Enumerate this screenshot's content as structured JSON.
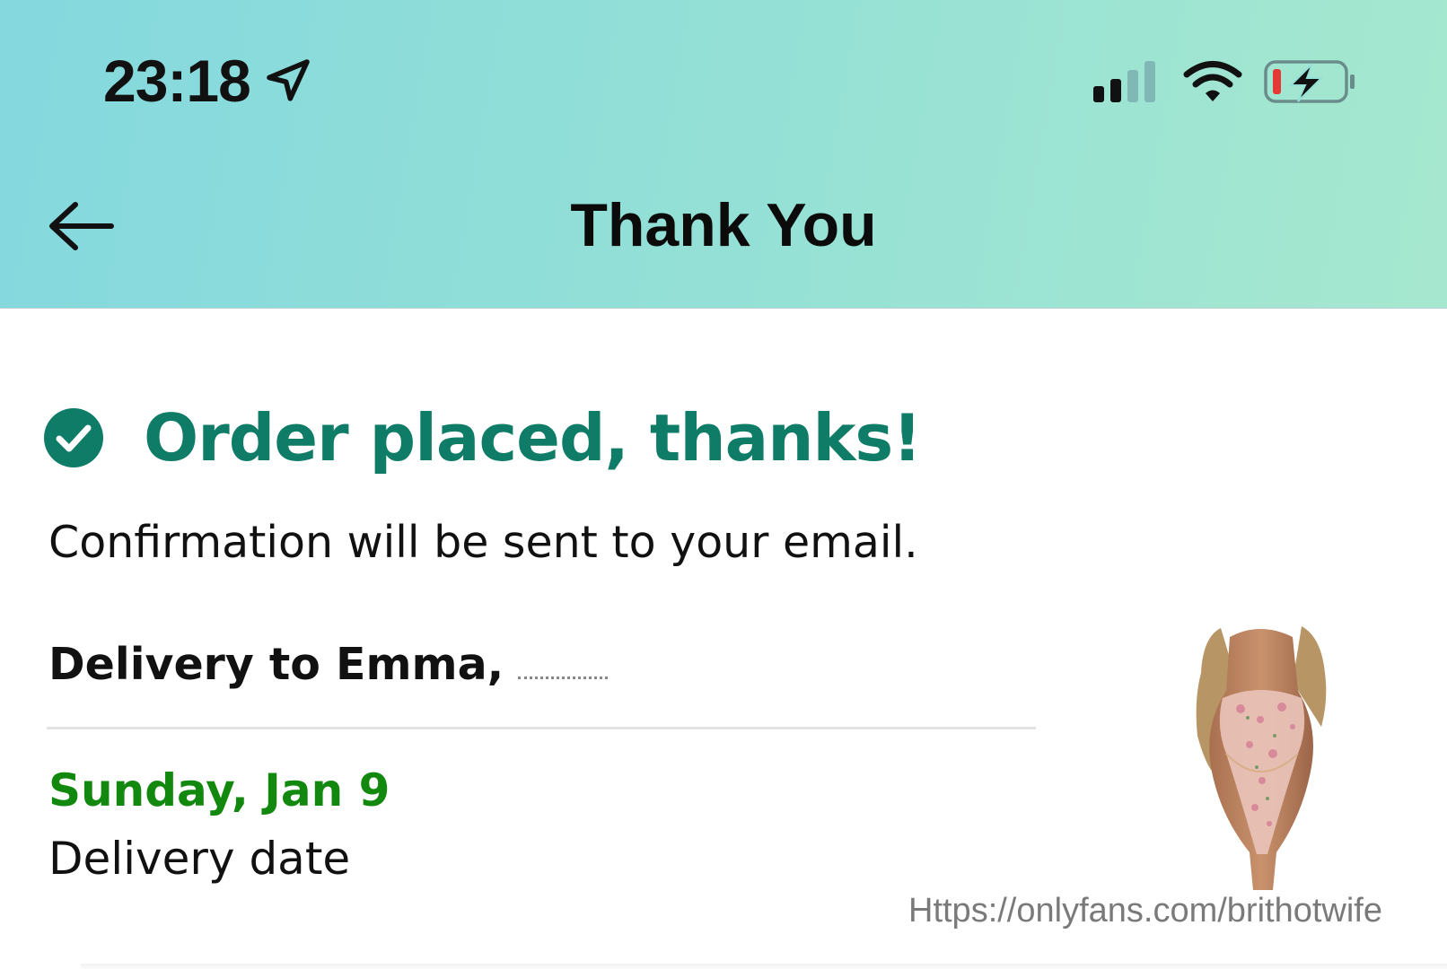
{
  "status_bar": {
    "time": "23:18",
    "icons": [
      "location-icon",
      "signal-icon",
      "wifi-icon",
      "battery-charging-icon"
    ],
    "battery_low_color": "#e53935"
  },
  "header": {
    "title": "Thank You",
    "back_icon": "back-arrow-icon",
    "gradient_start": "#84d8de",
    "gradient_end": "#a6e8cf"
  },
  "order": {
    "title": "Order placed, thanks!",
    "title_color": "#0f7c67",
    "confirmation": "Confirmation will be sent to your email.",
    "delivery_to": "Delivery to Emma,",
    "delivery_date_value": "Sunday, Jan 9",
    "delivery_date_color": "#12880e",
    "delivery_date_label": "Delivery date"
  },
  "product": {
    "image_icon": "product-thumbnail"
  },
  "watermark": "Https://onlyfans.com/brithotwife"
}
